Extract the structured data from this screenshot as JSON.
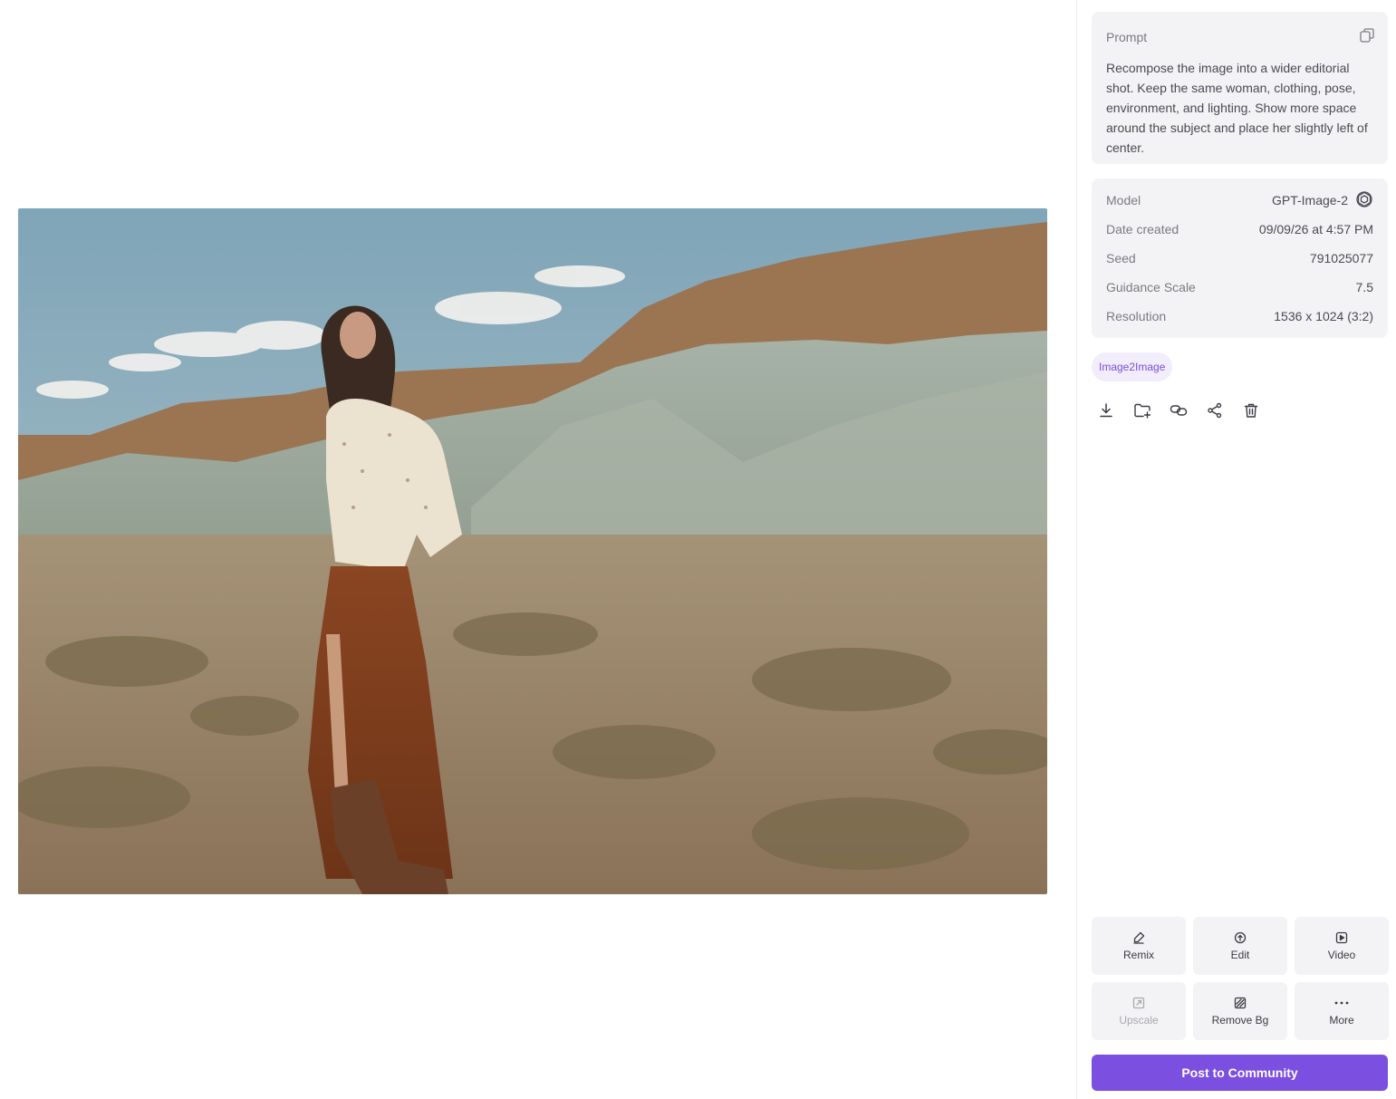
{
  "image": {
    "alt": "Woman in a patterned blouse and fringed suede skirt standing in a desert with layered mountains",
    "palette": {
      "sky": "#8fb0bf",
      "mountain": "#9aa89b",
      "ridge": "#8a6a4a",
      "ground": "#9c8466"
    }
  },
  "prompt": {
    "label": "Prompt",
    "text": "Recompose the image into a wider editorial shot. Keep the same woman, clothing, pose, environment, and lighting. Show more space around the subject and place her slightly left of center.",
    "copy_icon": "copy-icon"
  },
  "meta": {
    "model_label": "Model",
    "model_value": "GPT-Image-2",
    "model_icon": "openai-logo-icon",
    "date_label": "Date created",
    "date_value": "09/09/26 at 4:57 PM",
    "seed_label": "Seed",
    "seed_value": "791025077",
    "guidance_label": "Guidance Scale",
    "guidance_value": "7.5",
    "resolution_label": "Resolution",
    "resolution_value": "1536 x 1024 (3:2)"
  },
  "tag": {
    "label": "Image2Image"
  },
  "actions": [
    "download-icon",
    "add-to-folder-icon",
    "link-icon",
    "share-icon",
    "trash-icon"
  ],
  "tools": {
    "remix": "Remix",
    "edit": "Edit",
    "video": "Video",
    "upscale": "Upscale",
    "remove_bg": "Remove Bg",
    "more": "More"
  },
  "post_button": "Post to Community",
  "colors": {
    "accent": "#7b4fe0",
    "tag_bg": "#f1edfb",
    "tag_text": "#7c4ddb",
    "card_bg": "#f3f3f5"
  }
}
